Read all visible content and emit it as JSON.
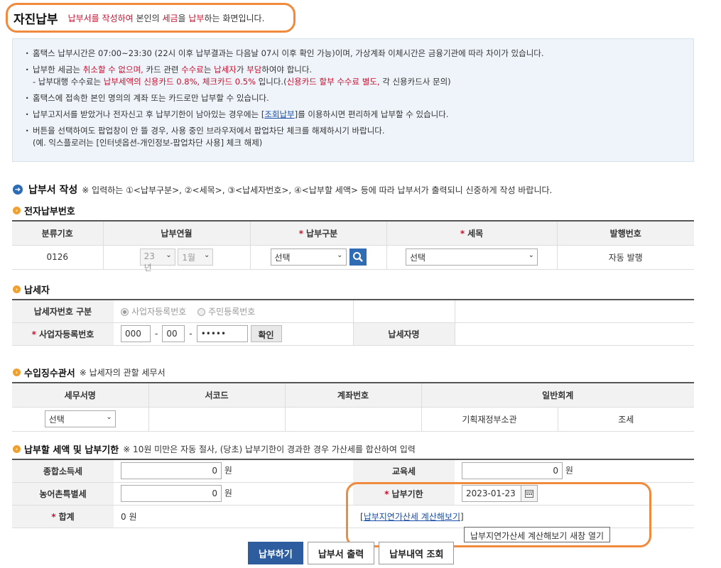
{
  "header": {
    "title": "자진납부",
    "sub_red1": "납부서를 작성하여",
    "sub_mid1": " 본인의 ",
    "sub_red2": "세금",
    "sub_mid2": "을 ",
    "sub_red3": "납부",
    "sub_end": "하는 화면입니다."
  },
  "info": {
    "line1": "홈택스 납부시간은 07:00~23:30 (22시 이후 납부결과는 다음날 07시 이후 확인 가능)이며, 가상계좌 이체시간은 금융기관에 따라 차이가 있습니다.",
    "line2_a": "납부한 세금는 ",
    "line2_b": "취소할 수 없으며,",
    "line2_c": " 카드 관련 ",
    "line2_d": "수수료",
    "line2_e": "는 ",
    "line2_f": "납세자",
    "line2_g": "가 ",
    "line2_h": "부담",
    "line2_i": "하여야 합니다.",
    "line2_sub_a": "- 납부대행 수수료는 ",
    "line2_sub_b": "납부세액의 신용카드 0.8%, 체크카드 0.5%",
    "line2_sub_c": " 입니다.(",
    "line2_sub_d": "신용카드 할부 수수료 별도,",
    "line2_sub_e": " 각 신용카드사 문의)",
    "line3": "홈택스에 접속한 본인 명의의 계좌 또는 카드로만 납부할 수 있습니다.",
    "line4_a": "납부고지서를 받았거나 전자신고 후 납부기한이 남아있는 경우에는 [",
    "line4_link": "조회납부",
    "line4_b": "]를 이용하시면 편리하게  납부할 수 있습니다.",
    "line5": "버튼을 선택하여도 팝업창이 안 뜰 경우, 사용 중인 브라우저에서 팝업차단 체크를 해제하시기 바랍니다.",
    "line5_sub": "(예. 익스플로러는 [인터넷옵션-개인정보-팝업차단 사용] 체크 해제)"
  },
  "write": {
    "title": "납부서 작성",
    "note": "※ 입력하는 ①<납부구분>, ②<세목>, ③<납세자번호>, ④<납부할 세액> 등에 따라 납부서가 출력되니 신중하게 작성 바랍니다."
  },
  "enum_section": {
    "title": "전자납부번호",
    "headers": [
      "분류기호",
      "납부연월",
      "납부구분",
      "세목",
      "발행번호"
    ],
    "class_code": "0126",
    "year": "23년",
    "month": "1월",
    "pay_type": "선택",
    "tax_item": "선택",
    "issue_no": "자동 발행"
  },
  "taxpayer": {
    "title": "납세자",
    "id_type_label": "납세자번호 구분",
    "opt_biz": "사업자등록번호",
    "opt_resident": "주민등록번호",
    "biz_no_label": "사업자등록번호",
    "biz1": "000",
    "biz2": "00",
    "biz3": "•••••",
    "confirm": "확인",
    "name_label": "납세자명"
  },
  "office": {
    "title": "수입징수관서",
    "note": "※ 납세자의 관할 세무서",
    "headers": [
      "세무서명",
      "서코드",
      "계좌번호",
      "일반회계"
    ],
    "office_select": "선택",
    "ministry": "기획재정부소관",
    "tax": "조세"
  },
  "amount": {
    "title": "납부할 세액 및 납부기한",
    "note": "※ 10원 미만은 자동 절사, (당초) 납부기한이 경과한 경우 가산세를 합산하여 입력",
    "income_label": "종합소득세",
    "income_val": "0",
    "edu_label": "교육세",
    "edu_val": "0",
    "rural_label": "농어촌특별세",
    "rural_val": "0",
    "due_label": "납부기한",
    "due_val": "2023-01-23",
    "total_label": "합계",
    "total_val": "0",
    "won": "원",
    "late_link": "납부지연가산세 계산해보기",
    "tooltip": "납부지연가산세 계산해보기 새창 열기"
  },
  "buttons": {
    "pay": "납부하기",
    "print": "납부서 출력",
    "history": "납부내역 조회"
  }
}
